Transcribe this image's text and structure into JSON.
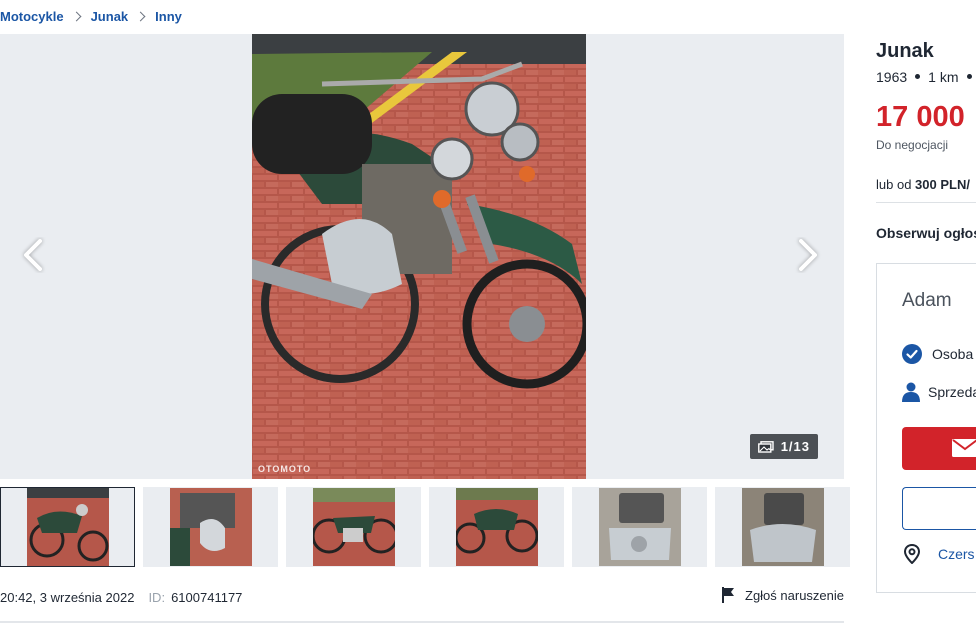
{
  "breadcrumb": [
    "Motocykle",
    "Junak",
    "Inny"
  ],
  "gallery": {
    "counter": "1/13",
    "watermark": "OTOMOTO",
    "thumbnail_count": 6
  },
  "meta": {
    "date": "20:42, 3 września 2022",
    "id_label": "ID:",
    "id_value": "6100741177",
    "report_label": "Zgłoś naruszenie"
  },
  "listing": {
    "title": "Junak",
    "year": "1963",
    "mileage": "1 km",
    "price": "17 000",
    "negotiation": "Do negocjacji",
    "finance_prefix": "lub od",
    "finance_value": "300 PLN/",
    "observe": "Obserwuj ogłos"
  },
  "seller": {
    "name": "Adam",
    "type": "Osoba",
    "role": "Sprzeda",
    "location": "Czers"
  },
  "colors": {
    "accent_blue": "#1b56a5",
    "price_red": "#d2232a",
    "gallery_bg": "#eaedf1"
  }
}
